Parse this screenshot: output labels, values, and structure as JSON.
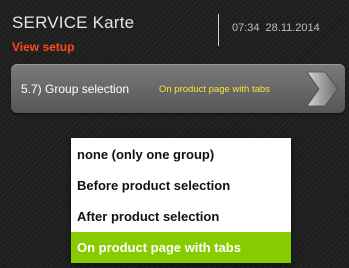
{
  "header": {
    "title": "SERVICE Karte",
    "subtitle": "View setup",
    "time": "07:34",
    "date": "28.11.2014"
  },
  "setting": {
    "label": "5.7) Group selection",
    "value": "On product page with tabs",
    "arrow_icon": "chevron-right-icon"
  },
  "dropdown": {
    "options": [
      {
        "label": "none (only one group)",
        "selected": false
      },
      {
        "label": "Before product selection",
        "selected": false
      },
      {
        "label": "After product selection",
        "selected": false
      },
      {
        "label": "On product page with tabs",
        "selected": true
      }
    ]
  },
  "colors": {
    "subtitle": "#ff4a1c",
    "value_text": "#f5e63a",
    "selected_option": "#86cc00"
  }
}
